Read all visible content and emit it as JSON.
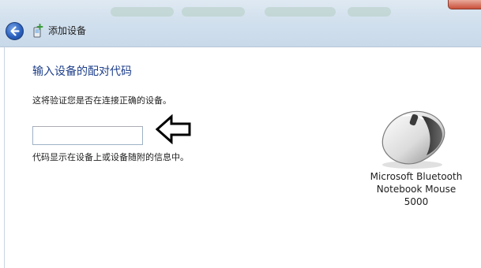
{
  "window": {
    "title": "添加设备",
    "back_icon": "back-arrow-icon",
    "title_icon": "add-device-icon"
  },
  "main": {
    "heading": "输入设备的配对代码",
    "description": "这将验证您是否在连接正确的设备。",
    "code_input": {
      "value": "",
      "placeholder": ""
    },
    "hint": "代码显示在设备上或设备随附的信息中。",
    "pointer_icon": "left-arrow-outline-icon"
  },
  "device": {
    "icon": "mouse-icon",
    "name_lines": [
      "Microsoft Bluetooth",
      "Notebook Mouse",
      "5000"
    ]
  },
  "colors": {
    "heading": "#1e3f8a",
    "text": "#1e1e1e",
    "titlebar": "#d3e1ee",
    "back_button": "#2c62c0",
    "close_button": "#c9503a"
  }
}
